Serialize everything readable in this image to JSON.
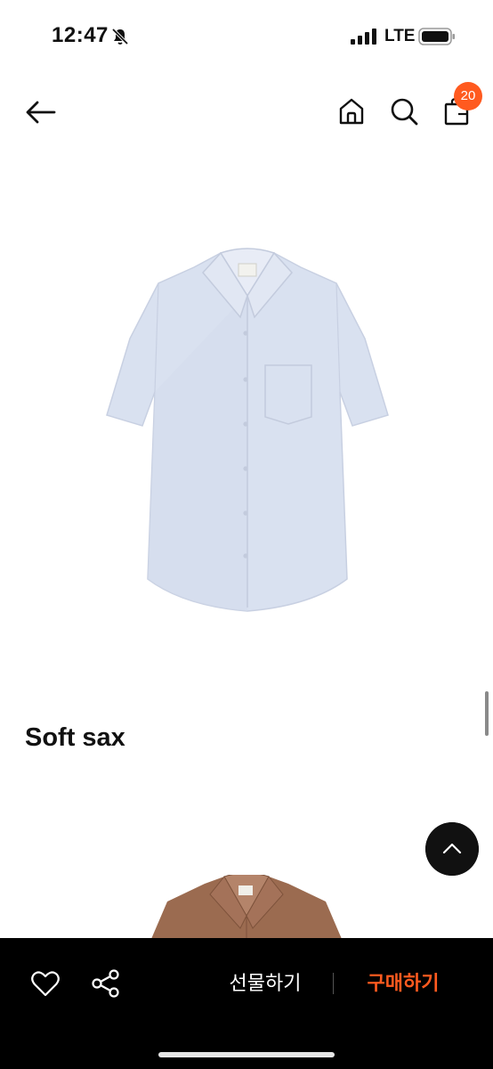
{
  "status_bar": {
    "time": "12:47",
    "network": "LTE",
    "bell_icon": "bell-muted-icon",
    "signal_icon": "signal-bars-icon",
    "battery_icon": "battery-icon"
  },
  "header": {
    "back_icon": "arrow-left-icon",
    "home_icon": "home-icon",
    "search_icon": "search-icon",
    "cart_icon": "shopping-bag-icon",
    "cart_count": "20"
  },
  "product": {
    "name": "Soft sax"
  },
  "floating": {
    "scroll_top_icon": "chevron-up-icon"
  },
  "bottom_bar": {
    "like_icon": "heart-icon",
    "share_icon": "share-icon",
    "gift_label": "선물하기",
    "buy_label": "구매하기"
  },
  "colors": {
    "accent": "#ff5a1f",
    "bar_background": "#000000",
    "shirt_color": "#d6deef",
    "shirt_2_color": "#9a6a4f"
  }
}
